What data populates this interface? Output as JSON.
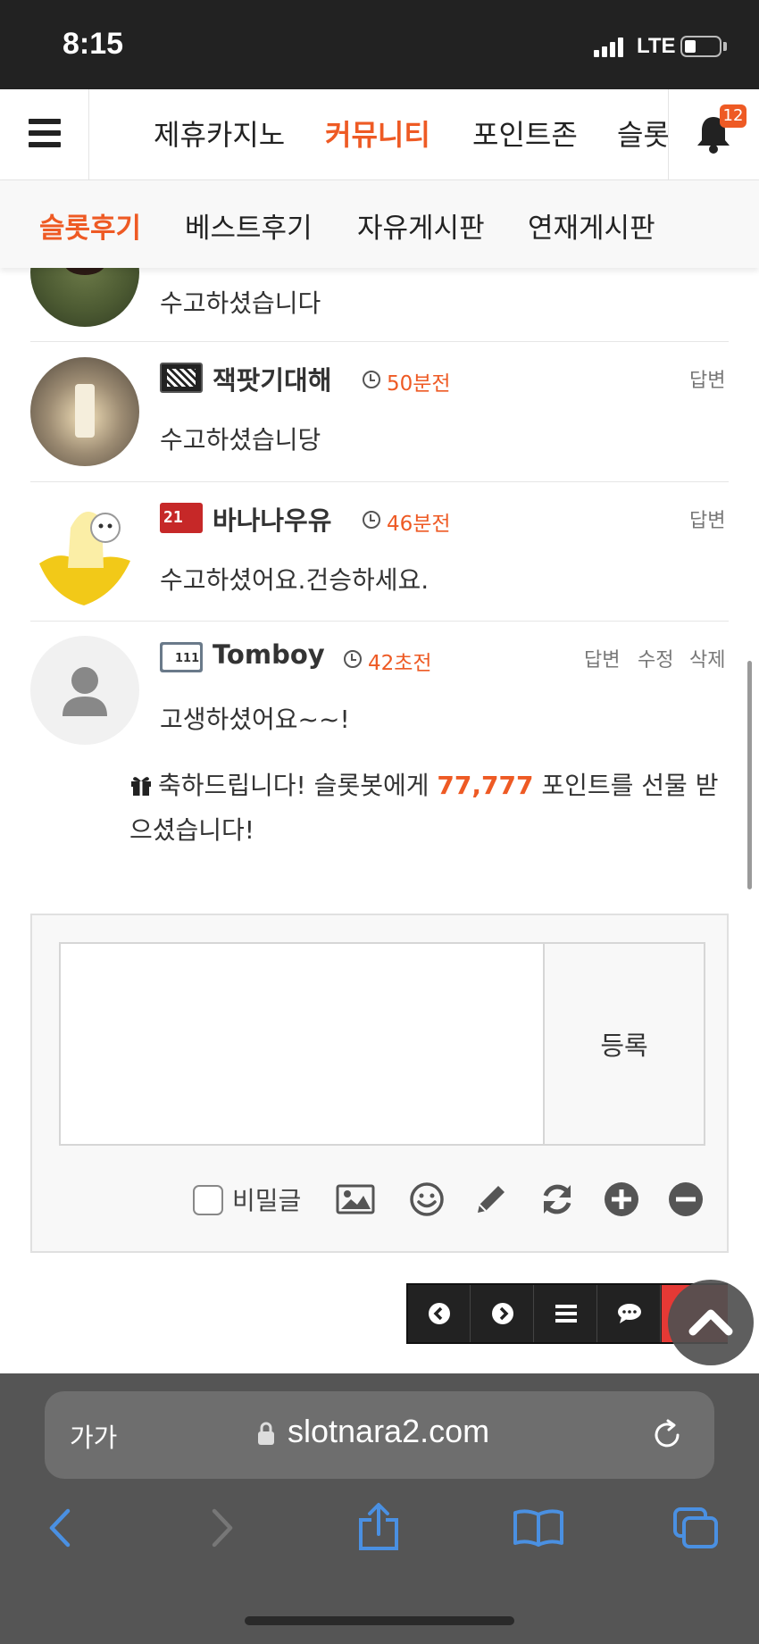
{
  "status_bar": {
    "time": "8:15",
    "network": "LTE"
  },
  "top_nav": {
    "items": [
      {
        "label": "제휴카지노"
      },
      {
        "label": "커뮤니티"
      },
      {
        "label": "포인트존"
      },
      {
        "label": "슬롯"
      }
    ],
    "active_index": 1,
    "notification_count": "12"
  },
  "sub_nav": {
    "items": [
      {
        "label": "슬롯후기"
      },
      {
        "label": "베스트후기"
      },
      {
        "label": "자유게시판"
      },
      {
        "label": "연재게시판"
      }
    ],
    "active_index": 0
  },
  "comments": [
    {
      "text": "수고하셨습니다"
    },
    {
      "author": "잭팟기대해",
      "time": "50분전",
      "text": "수고하셨습니당",
      "actions": [
        "답변"
      ]
    },
    {
      "author": "바나나우유",
      "time": "46분전",
      "text": "수고하셨어요.건승하세요.",
      "actions": [
        "답변"
      ]
    },
    {
      "author": "Tomboy",
      "time": "42초전",
      "text": "고생하셨어요~~!",
      "actions": [
        "답변",
        "수정",
        "삭제"
      ],
      "gift": {
        "before": "축하드립니다! 슬롯봇에게 ",
        "points": "77,777",
        "after": " 포인트를 선물 받으셨습니다!"
      }
    }
  ],
  "comment_form": {
    "submit_label": "등록",
    "secret_label": "비밀글",
    "tools": [
      "image-icon",
      "emoji-icon",
      "pencil-icon",
      "refresh-icon",
      "zoom-in-icon",
      "zoom-out-icon"
    ]
  },
  "pager": [
    "prev-icon",
    "next-icon",
    "list-icon",
    "comment-icon",
    "write-icon"
  ],
  "browser": {
    "text_size_label": "가가",
    "url": "slotnara2.com"
  },
  "colors": {
    "accent": "#ee5a24",
    "status_bar": "#222222",
    "browser_bar": "#555555"
  }
}
